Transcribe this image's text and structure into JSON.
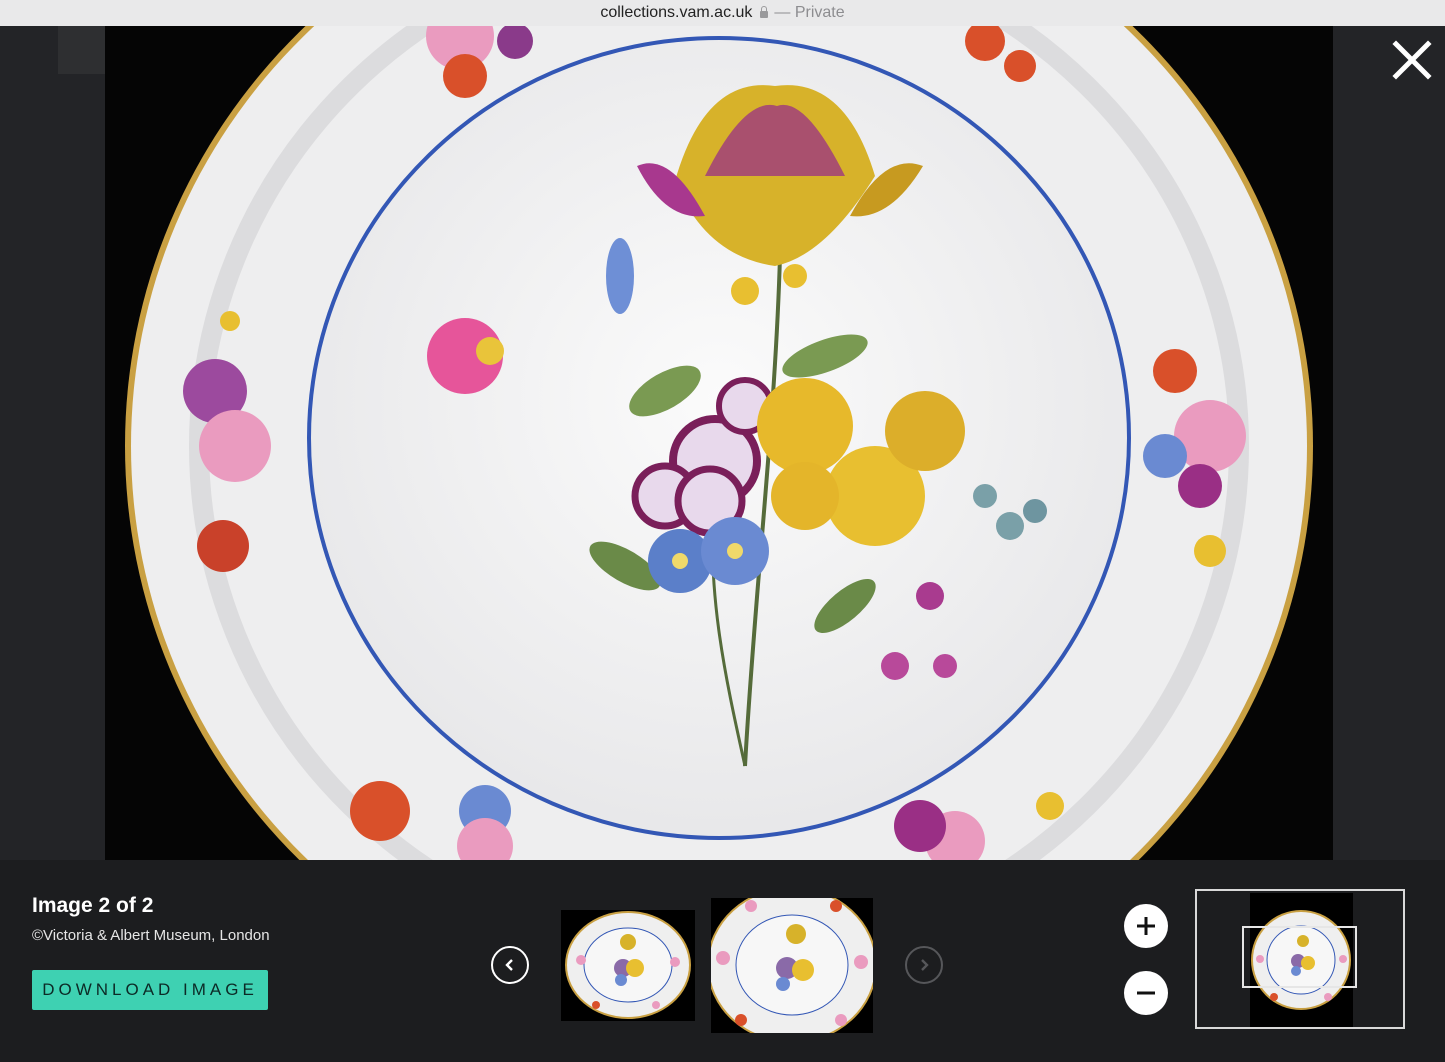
{
  "browser": {
    "url": "collections.vam.ac.uk",
    "mode": "— Private"
  },
  "viewer": {
    "image_counter": "Image 2 of 2",
    "credit": "©Victoria & Albert Museum, London",
    "download_label": "DOWNLOAD IMAGE",
    "accent_color": "#3ed1b2",
    "icons": {
      "close": "close-icon",
      "prev": "chevron-left-icon",
      "next": "chevron-right-icon",
      "zoom_in": "plus-icon",
      "zoom_out": "minus-icon"
    },
    "thumbnails": [
      "image-1",
      "image-2"
    ],
    "selected_thumbnail": 2
  }
}
